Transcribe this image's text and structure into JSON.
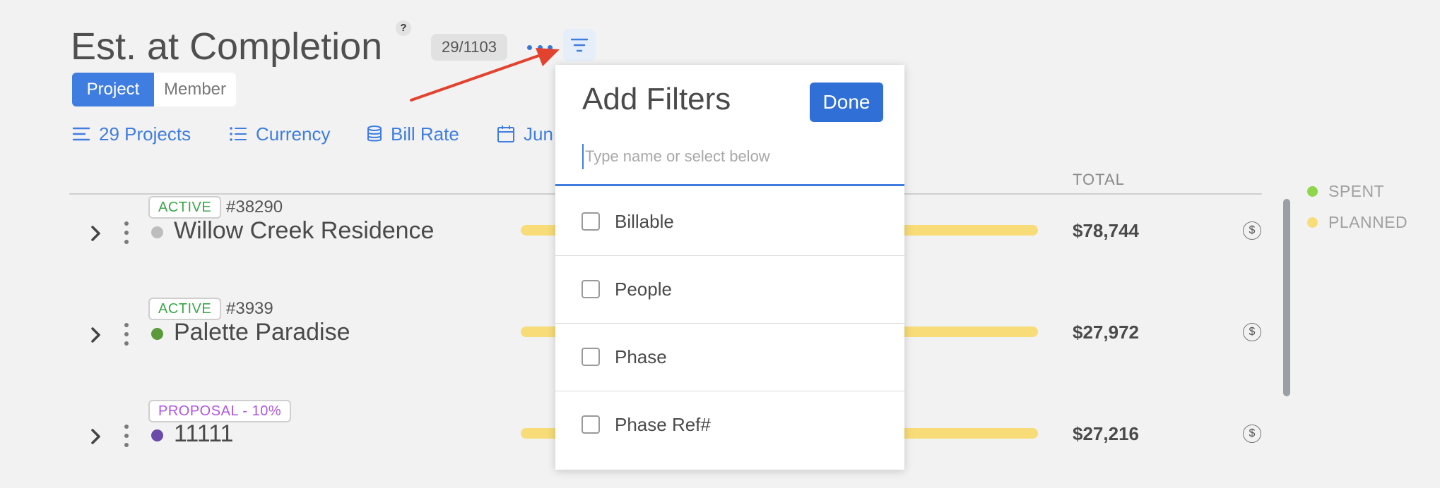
{
  "header": {
    "title": "Est. at Completion",
    "help": "?",
    "count": "29/1103"
  },
  "view_toggle": {
    "options": [
      "Project",
      "Member"
    ],
    "selected": "Project"
  },
  "toolbar": {
    "items": [
      {
        "label": "29 Projects",
        "icon": "list-lines-icon"
      },
      {
        "label": "Currency",
        "icon": "bullet-list-icon"
      },
      {
        "label": "Bill Rate",
        "icon": "database-icon"
      },
      {
        "label": "Jun",
        "icon": "calendar-icon"
      }
    ]
  },
  "table": {
    "total_header": "TOTAL",
    "rows": [
      {
        "status": "ACTIVE",
        "status_type": "active",
        "number": "#38290",
        "name": "Willow Creek Residence",
        "dot_color": "#bdbdbd",
        "total": "$78,744",
        "dollar": "$"
      },
      {
        "status": "ACTIVE",
        "status_type": "active",
        "number": "#3939",
        "name": "Palette Paradise",
        "dot_color": "#5a9a3a",
        "total": "$27,972",
        "dollar": "$"
      },
      {
        "status": "PROPOSAL - 10%",
        "status_type": "proposal",
        "number": "",
        "name": "11111",
        "dot_color": "#6a4aa8",
        "total": "$27,216",
        "dollar": "$"
      }
    ]
  },
  "legend": {
    "items": [
      {
        "label": "SPENT",
        "color": "#8ed64a"
      },
      {
        "label": "PLANNED",
        "color": "#f7dc78"
      }
    ]
  },
  "filters_modal": {
    "title": "Add Filters",
    "done_label": "Done",
    "search_placeholder": "Type name or select below",
    "options": [
      {
        "label": "Billable",
        "checked": false
      },
      {
        "label": "People",
        "checked": false
      },
      {
        "label": "Phase",
        "checked": false
      },
      {
        "label": "Phase Ref#",
        "checked": false
      }
    ]
  },
  "colors": {
    "accent": "#3f7de0",
    "annotation_arrow": "#e2432f"
  }
}
